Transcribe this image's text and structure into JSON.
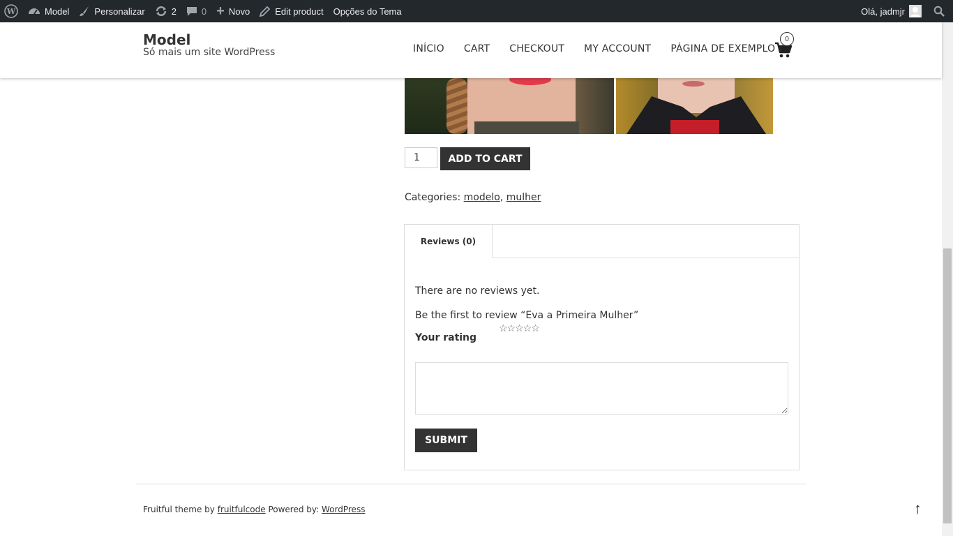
{
  "adminbar": {
    "wp_logo_icon": "wordpress-logo-icon",
    "site_name": "Model",
    "customize": "Personalizar",
    "updates_count": "2",
    "comments_count": "0",
    "new_label": "Novo",
    "edit_product": "Edit product",
    "theme_options": "Opções do Tema",
    "greeting": "Olá, jadmjr"
  },
  "site": {
    "title": "Model",
    "description": "Só mais um site WordPress"
  },
  "nav": {
    "items": [
      "INÍCIO",
      "CART",
      "CHECKOUT",
      "MY ACCOUNT",
      "PÁGINA DE EXEMPLO"
    ],
    "cart_count": "0"
  },
  "product": {
    "quantity": "1",
    "add_to_cart": "ADD TO CART",
    "categories_label": "Categories:",
    "categories": [
      "modelo",
      "mulher"
    ],
    "category_separator": ","
  },
  "reviews": {
    "tab_label": "Reviews (0)",
    "no_reviews": "There are no reviews yet.",
    "first_review": "Be the first to review “Eva a Primeira Mulher”",
    "rating_label": "Your rating",
    "stars": "☆☆☆☆☆",
    "submit": "SUBMIT"
  },
  "footer": {
    "text_prefix": "Fruitful theme by",
    "link1": "fruitfulcode",
    "text_middle": "Powered by:",
    "link2": "WordPress",
    "to_top": "↑"
  },
  "colors": {
    "adminbar_bg": "#23282d",
    "button_bg": "#333333",
    "text": "#333333"
  }
}
